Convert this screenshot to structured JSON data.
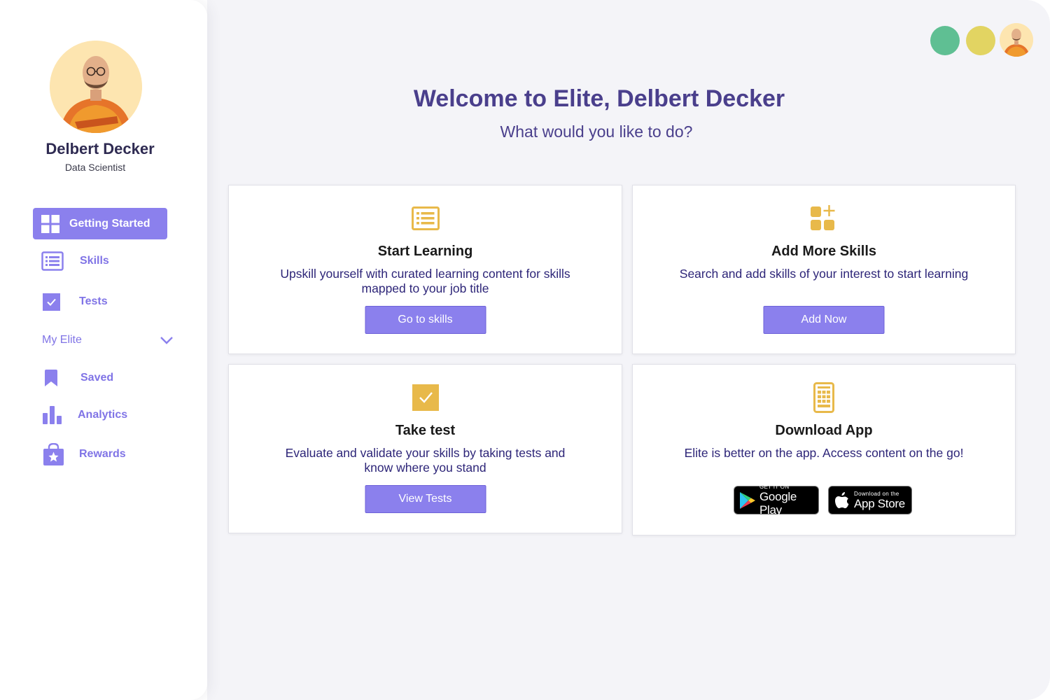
{
  "profile": {
    "name": "Delbert Decker",
    "role": "Data Scientist"
  },
  "nav": {
    "getting_started": "Getting Started",
    "skills": "Skills",
    "tests": "Tests",
    "my_elite": "My Elite",
    "saved": "Saved",
    "analytics": "Analytics",
    "rewards": "Rewards"
  },
  "header": {
    "title": "Welcome to Elite, Delbert Decker",
    "subtitle": "What would you like to do?"
  },
  "cards": [
    {
      "icon": "list-icon",
      "title": "Start Learning",
      "description": "Upskill yourself with curated learning content for skills mapped to your job title",
      "button": "Go to skills"
    },
    {
      "icon": "add-apps-icon",
      "title": "Add More Skills",
      "description": "Search and add skills of your interest to start learning",
      "button": "Add Now"
    },
    {
      "icon": "checkbox-icon",
      "title": "Take test",
      "description": "Evaluate and validate your skills by taking tests and know where you stand",
      "button": "View Tests"
    },
    {
      "icon": "phone-app-icon",
      "title": "Download App",
      "description": "Elite is better on the app. Access content on the go!"
    }
  ],
  "badges": {
    "google_small": "GET IT ON",
    "google_big": "Google Play",
    "apple_small": "Download on the",
    "apple_big": "App Store"
  },
  "colors": {
    "accent": "#8b80ed",
    "title": "#4a3f8c",
    "icon_gold": "#e8b94a",
    "status_green": "#5fbf93",
    "status_yellow": "#e2d462"
  }
}
